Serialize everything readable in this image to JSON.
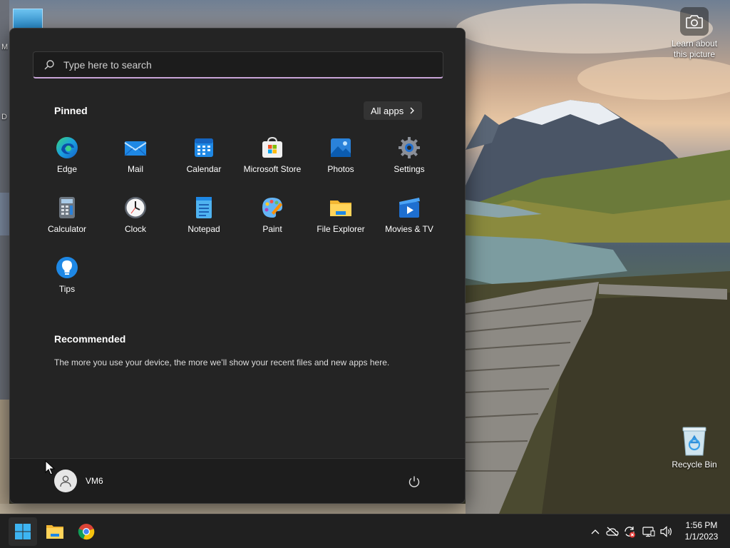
{
  "desktop": {
    "camera_label": "Learn about this picture",
    "recycle_bin_label": "Recycle Bin",
    "left_stub_1": "M",
    "left_stub_2": "D"
  },
  "start_menu": {
    "search": {
      "placeholder": "Type here to search"
    },
    "pinned_title": "Pinned",
    "all_apps_label": "All apps",
    "pinned_apps": [
      {
        "label": "Edge",
        "icon": "edge-icon"
      },
      {
        "label": "Mail",
        "icon": "mail-icon"
      },
      {
        "label": "Calendar",
        "icon": "calendar-icon"
      },
      {
        "label": "Microsoft Store",
        "icon": "store-icon"
      },
      {
        "label": "Photos",
        "icon": "photos-icon"
      },
      {
        "label": "Settings",
        "icon": "gear-icon"
      },
      {
        "label": "Calculator",
        "icon": "calculator-icon"
      },
      {
        "label": "Clock",
        "icon": "clock-icon"
      },
      {
        "label": "Notepad",
        "icon": "notepad-icon"
      },
      {
        "label": "Paint",
        "icon": "paint-icon"
      },
      {
        "label": "File Explorer",
        "icon": "folder-icon"
      },
      {
        "label": "Movies & TV",
        "icon": "movies-icon"
      },
      {
        "label": "Tips",
        "icon": "lightbulb-icon"
      }
    ],
    "recommended_title": "Recommended",
    "recommended_text": "The more you use your device, the more we’ll show your recent files and new apps here.",
    "user_name": "VM6"
  },
  "taskbar": {
    "time": "1:56 PM",
    "date": "1/1/2023"
  },
  "colors": {
    "menu_bg": "#242424",
    "accent_search_underline": "#c8a4d8",
    "taskbar_bg": "#202020"
  }
}
